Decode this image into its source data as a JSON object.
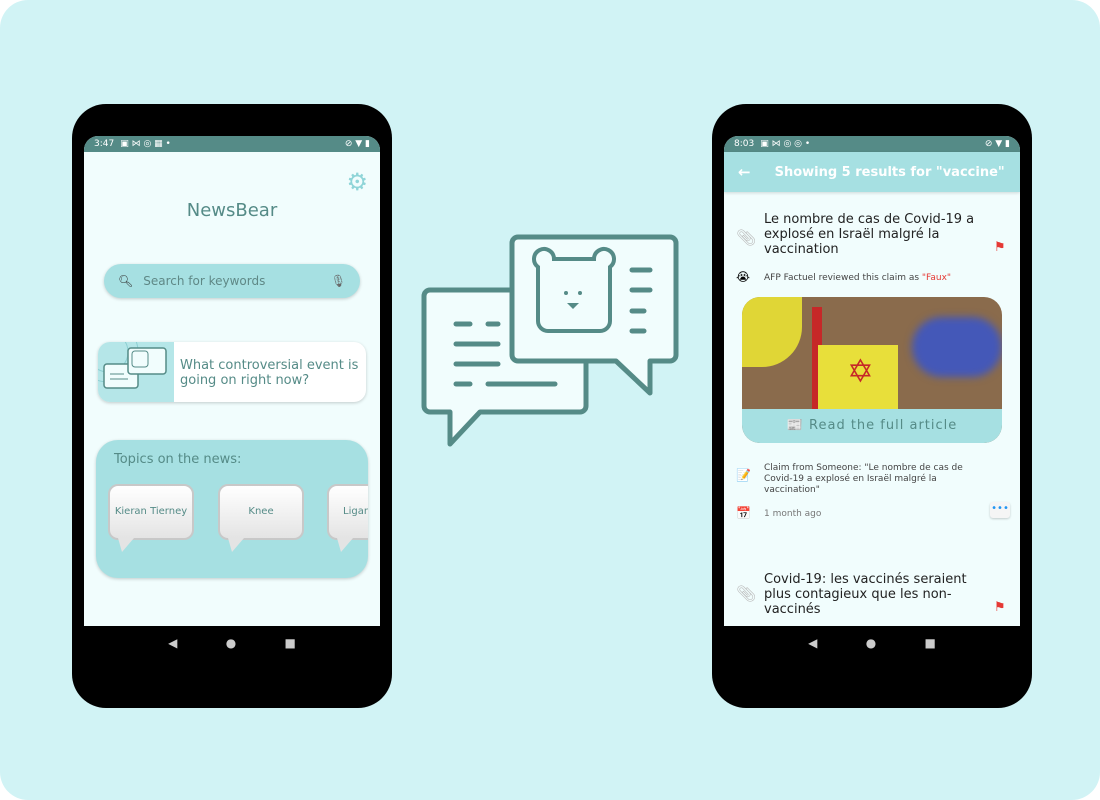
{
  "left_phone": {
    "status": {
      "time": "3:47"
    },
    "app_title": "NewsBear",
    "search": {
      "placeholder": "Search for keywords"
    },
    "prompt_card": {
      "text": "What controversial event is going on right now?"
    },
    "topics": {
      "heading": "Topics on the news:",
      "items": [
        "Kieran Tierney",
        "Knee",
        "Ligament"
      ]
    }
  },
  "right_phone": {
    "status": {
      "time": "8:03"
    },
    "header": "Showing 5 results for \"vaccine\"",
    "results": [
      {
        "title": "Le nombre de cas de Covid-19 a explosé en Israël malgré la vaccination",
        "review_prefix": "AFP Factuel reviewed this claim as ",
        "rating": "\"Faux\"",
        "read_more": "📰 Read the full article",
        "claim": "Claim from Someone: \"Le nombre de cas de Covid-19 a explosé en Israël malgré la vaccination\"",
        "date": "1 month ago"
      },
      {
        "title": "Covid-19: les vaccinés seraient plus contagieux que les non-vaccinés"
      }
    ]
  },
  "colors": {
    "accent": "#558b87",
    "light": "#a6e0e2",
    "background": "#d1f3f5",
    "rating": "#e53935"
  }
}
